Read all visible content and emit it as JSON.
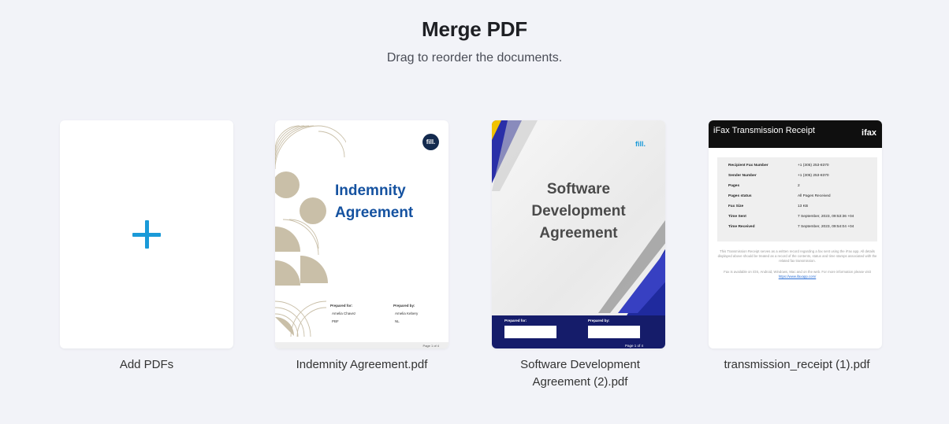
{
  "header": {
    "title": "Merge PDF",
    "subtitle": "Drag to reorder the documents."
  },
  "add_card": {
    "label": "Add PDFs",
    "icon": "plus-icon",
    "accent": "#1a9ad8"
  },
  "documents": [
    {
      "filename": "Indemnity Agreement.pdf",
      "preview": {
        "logo": "fill.",
        "title_line1": "Indemnity",
        "title_line2": "Agreement",
        "prepared_for": "Prepared for:",
        "prepared_by": "Prepared by:",
        "for_name": "Amelia Chavez",
        "for_company": "PBF",
        "by_name": "Amelia Kebery",
        "by_company": "NL",
        "footer": "Page 1 of 4"
      }
    },
    {
      "filename_line1": "Software Development",
      "filename_line2": "Agreement (2).pdf",
      "preview": {
        "logo": "fill.",
        "title_line1": "Software",
        "title_line2": "Development",
        "title_line3": "Agreement",
        "prepared_for": "Prepared for:",
        "prepared_by": "Prepared by:",
        "footer": "Page 1 of 4"
      }
    },
    {
      "filename": "transmission_receipt (1).pdf",
      "preview": {
        "title": "iFax Transmission Receipt",
        "logo": "ifax",
        "rows": [
          [
            "Recipient Fax Number",
            "+1 (305) 253-8370"
          ],
          [
            "Sender Number",
            "+1 (305) 253-8370"
          ],
          [
            "Pages",
            "2"
          ],
          [
            "Pages status",
            "All Pages Received"
          ],
          [
            "Fax Size",
            "13 KB"
          ],
          [
            "Time Sent",
            "7 September, 2023, 09:53:36 +04"
          ],
          [
            "Time Received",
            "7 September, 2023, 09:54:04 +04"
          ]
        ],
        "note1": "This Transmission Receipt serves as a written record regarding a fax sent using the iFax app. All details displayed above should be treated as a record of the contents, status and time stamps associated with the related fax transmission.",
        "note2": "Fax is available on iOS, Android, Windows, Mac and on the web. For more information please visit",
        "link": "https://www.ifaxapp.com/"
      }
    }
  ]
}
